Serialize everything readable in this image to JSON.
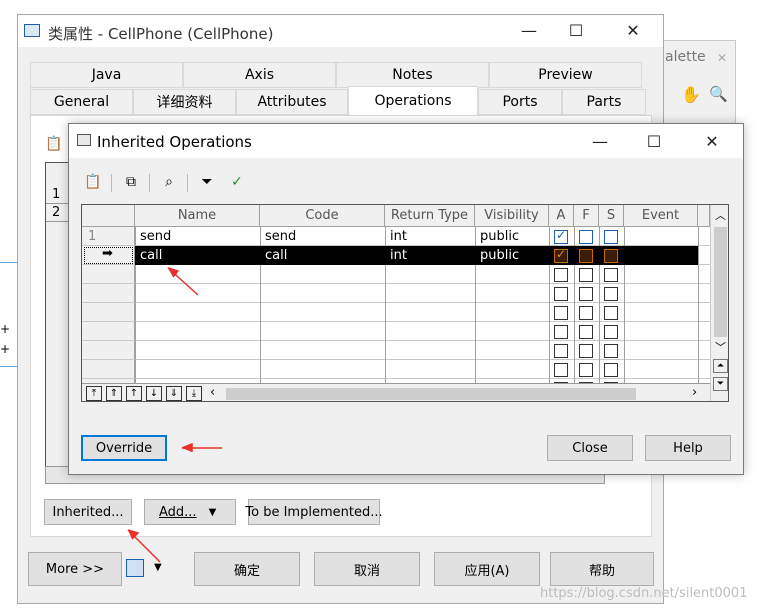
{
  "main_window": {
    "title": "类属性 - CellPhone (CellPhone)",
    "tabs_row1": [
      "Java",
      "Axis",
      "Notes",
      "Preview"
    ],
    "tabs_row2": [
      "General",
      "详细资料",
      "Attributes",
      "Operations",
      "Ports",
      "Parts"
    ],
    "row_numbers": [
      "1",
      "2"
    ],
    "buttons": {
      "inherited": "Inherited...",
      "add": "Add...",
      "to_be_implemented": "To be Implemented...",
      "more": "More >>",
      "ok": "确定",
      "cancel": "取消",
      "apply": "应用(A)",
      "help": "帮助"
    }
  },
  "palette": {
    "title": "alette"
  },
  "dialog": {
    "title": "Inherited Operations",
    "columns": [
      "Name",
      "Code",
      "Return Type",
      "Visibility",
      "A",
      "F",
      "S",
      "Event"
    ],
    "rows": [
      {
        "num": "1",
        "name": "send",
        "code": "send",
        "return_type": "int",
        "visibility": "public",
        "a": true,
        "f": false,
        "s": false,
        "selected": false
      },
      {
        "num": "",
        "name": "call",
        "code": "call",
        "return_type": "int",
        "visibility": "public",
        "a": true,
        "f": false,
        "s": false,
        "selected": true
      }
    ],
    "buttons": {
      "override": "Override",
      "close": "Close",
      "help": "Help"
    }
  },
  "watermark": "https://blog.csdn.net/silent0001",
  "colors": {
    "accent": "#0078d7",
    "selected_row": "#000000",
    "annotation": "#e8302a"
  }
}
